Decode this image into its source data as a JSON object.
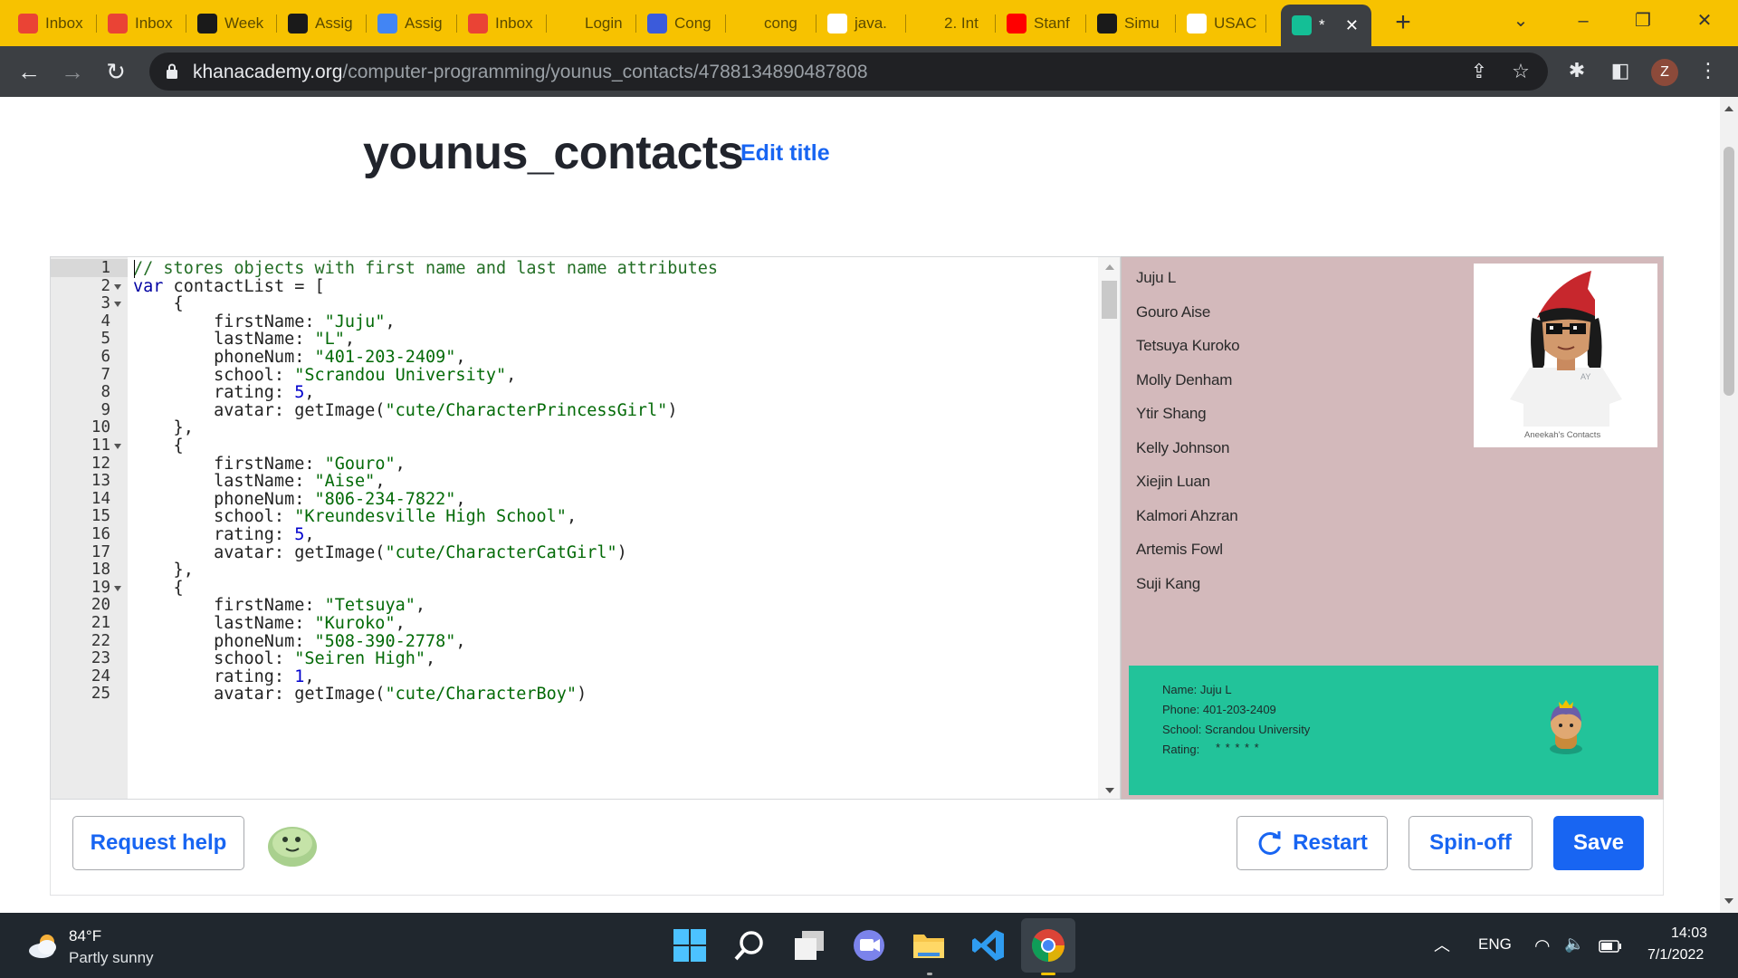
{
  "browser": {
    "tabs": [
      {
        "label": "Inbox",
        "icon": "gmail-icon",
        "color": "#ea4335"
      },
      {
        "label": "Inbox",
        "icon": "gmail-icon",
        "color": "#ea4335"
      },
      {
        "label": "Week",
        "icon": "d2l-icon",
        "color": "#1a1a1a"
      },
      {
        "label": "Assig",
        "icon": "d2l-icon",
        "color": "#1a1a1a"
      },
      {
        "label": "Assig",
        "icon": "google-docs-icon",
        "color": "#4285f4"
      },
      {
        "label": "Inbox",
        "icon": "gmail-icon",
        "color": "#ea4335"
      },
      {
        "label": "Login",
        "icon": "canvas-icon",
        "color": "#f7c200"
      },
      {
        "label": "Cong",
        "icon": "m-icon",
        "color": "#3b5bdb"
      },
      {
        "label": "cong",
        "icon": "wh-icon",
        "color": "#f7c200"
      },
      {
        "label": "java.",
        "icon": "globe-icon",
        "color": "#ffffff"
      },
      {
        "label": "2. Int",
        "icon": "pencil-icon",
        "color": "#f7c200"
      },
      {
        "label": "Stanf",
        "icon": "youtube-icon",
        "color": "#ff0000"
      },
      {
        "label": "Simu",
        "icon": "simulation-icon",
        "color": "#1a1a1a"
      },
      {
        "label": "USAC",
        "icon": "globe-icon",
        "color": "#ffffff"
      },
      {
        "label": "*",
        "icon": "khan-academy-icon",
        "color": "#14bf96"
      }
    ],
    "new_tab": "+",
    "url_host": "khanacademy.org",
    "url_path": "/computer-programming/younus_contacts/4788134890487808",
    "profile_initial": "Z"
  },
  "page": {
    "title": "younus_contacts",
    "edit_title": "Edit title"
  },
  "editor": {
    "line_numbers": [
      "1",
      "2",
      "3",
      "4",
      "5",
      "6",
      "7",
      "8",
      "9",
      "10",
      "11",
      "12",
      "13",
      "14",
      "15",
      "16",
      "17",
      "18",
      "19",
      "20",
      "21",
      "22",
      "23",
      "24",
      "25"
    ],
    "fold_lines": [
      2,
      3,
      11,
      19
    ],
    "lines": [
      [
        {
          "t": "// stores objects with first name and last name attributes",
          "c": "comment"
        }
      ],
      [
        {
          "t": "var",
          "c": "kw"
        },
        {
          "t": " contactList = [",
          "c": ""
        }
      ],
      [
        {
          "t": "    {",
          "c": ""
        }
      ],
      [
        {
          "t": "        firstName: ",
          "c": ""
        },
        {
          "t": "\"Juju\"",
          "c": "str"
        },
        {
          "t": ",",
          "c": ""
        }
      ],
      [
        {
          "t": "        lastName: ",
          "c": ""
        },
        {
          "t": "\"L\"",
          "c": "str"
        },
        {
          "t": ",",
          "c": ""
        }
      ],
      [
        {
          "t": "        phoneNum: ",
          "c": ""
        },
        {
          "t": "\"401-203-2409\"",
          "c": "str"
        },
        {
          "t": ",",
          "c": ""
        }
      ],
      [
        {
          "t": "        school: ",
          "c": ""
        },
        {
          "t": "\"Scrandou University\"",
          "c": "str"
        },
        {
          "t": ",",
          "c": ""
        }
      ],
      [
        {
          "t": "        rating: ",
          "c": ""
        },
        {
          "t": "5",
          "c": "num"
        },
        {
          "t": ",",
          "c": ""
        }
      ],
      [
        {
          "t": "        avatar: getImage(",
          "c": ""
        },
        {
          "t": "\"cute/CharacterPrincessGirl\"",
          "c": "str"
        },
        {
          "t": ")",
          "c": ""
        }
      ],
      [
        {
          "t": "    },",
          "c": ""
        }
      ],
      [
        {
          "t": "    {",
          "c": ""
        }
      ],
      [
        {
          "t": "        firstName: ",
          "c": ""
        },
        {
          "t": "\"Gouro\"",
          "c": "str"
        },
        {
          "t": ",",
          "c": ""
        }
      ],
      [
        {
          "t": "        lastName: ",
          "c": ""
        },
        {
          "t": "\"Aise\"",
          "c": "str"
        },
        {
          "t": ",",
          "c": ""
        }
      ],
      [
        {
          "t": "        phoneNum: ",
          "c": ""
        },
        {
          "t": "\"806-234-7822\"",
          "c": "str"
        },
        {
          "t": ",",
          "c": ""
        }
      ],
      [
        {
          "t": "        school: ",
          "c": ""
        },
        {
          "t": "\"Kreundesville High School\"",
          "c": "str"
        },
        {
          "t": ",",
          "c": ""
        }
      ],
      [
        {
          "t": "        rating: ",
          "c": ""
        },
        {
          "t": "5",
          "c": "num"
        },
        {
          "t": ",",
          "c": ""
        }
      ],
      [
        {
          "t": "        avatar: getImage(",
          "c": ""
        },
        {
          "t": "\"cute/CharacterCatGirl\"",
          "c": "str"
        },
        {
          "t": ")",
          "c": ""
        }
      ],
      [
        {
          "t": "    },",
          "c": ""
        }
      ],
      [
        {
          "t": "    {",
          "c": ""
        }
      ],
      [
        {
          "t": "        firstName: ",
          "c": ""
        },
        {
          "t": "\"Tetsuya\"",
          "c": "str"
        },
        {
          "t": ",",
          "c": ""
        }
      ],
      [
        {
          "t": "        lastName: ",
          "c": ""
        },
        {
          "t": "\"Kuroko\"",
          "c": "str"
        },
        {
          "t": ",",
          "c": ""
        }
      ],
      [
        {
          "t": "        phoneNum: ",
          "c": ""
        },
        {
          "t": "\"508-390-2778\"",
          "c": "str"
        },
        {
          "t": ",",
          "c": ""
        }
      ],
      [
        {
          "t": "        school: ",
          "c": ""
        },
        {
          "t": "\"Seiren High\"",
          "c": "str"
        },
        {
          "t": ",",
          "c": ""
        }
      ],
      [
        {
          "t": "        rating: ",
          "c": ""
        },
        {
          "t": "1",
          "c": "num"
        },
        {
          "t": ",",
          "c": ""
        }
      ],
      [
        {
          "t": "        avatar: getImage(",
          "c": ""
        },
        {
          "t": "\"cute/CharacterBoy\"",
          "c": "str"
        },
        {
          "t": ")",
          "c": ""
        }
      ]
    ]
  },
  "output": {
    "contacts": [
      "Juju L",
      "Gouro Aise",
      "Tetsuya Kuroko",
      "Molly Denham",
      "Ytir Shang",
      "Kelly Johnson",
      "Xiejin Luan",
      "Kalmori Ahzran",
      "Artemis Fowl",
      "Suji Kang"
    ],
    "photo_badge": "AY",
    "photo_caption": "Aneekah's Contacts",
    "details": {
      "name": "Name: Juju L",
      "phone": "Phone: 401-203-2409",
      "school": "School: Scrandou University",
      "rating_label": "Rating:",
      "rating_stars": "* * * * *"
    }
  },
  "buttons": {
    "request_help": "Request help",
    "restart": "Restart",
    "spin_off": "Spin-off",
    "save": "Save"
  },
  "taskbar": {
    "temperature": "84°F",
    "weather": "Partly sunny",
    "language": "ENG",
    "time": "14:03",
    "date": "7/1/2022"
  },
  "colors": {
    "accent": "#1865f2",
    "tabstrip": "#f7c200",
    "canvas_bg": "#d3b9bb",
    "detail_card": "#22c39a"
  }
}
